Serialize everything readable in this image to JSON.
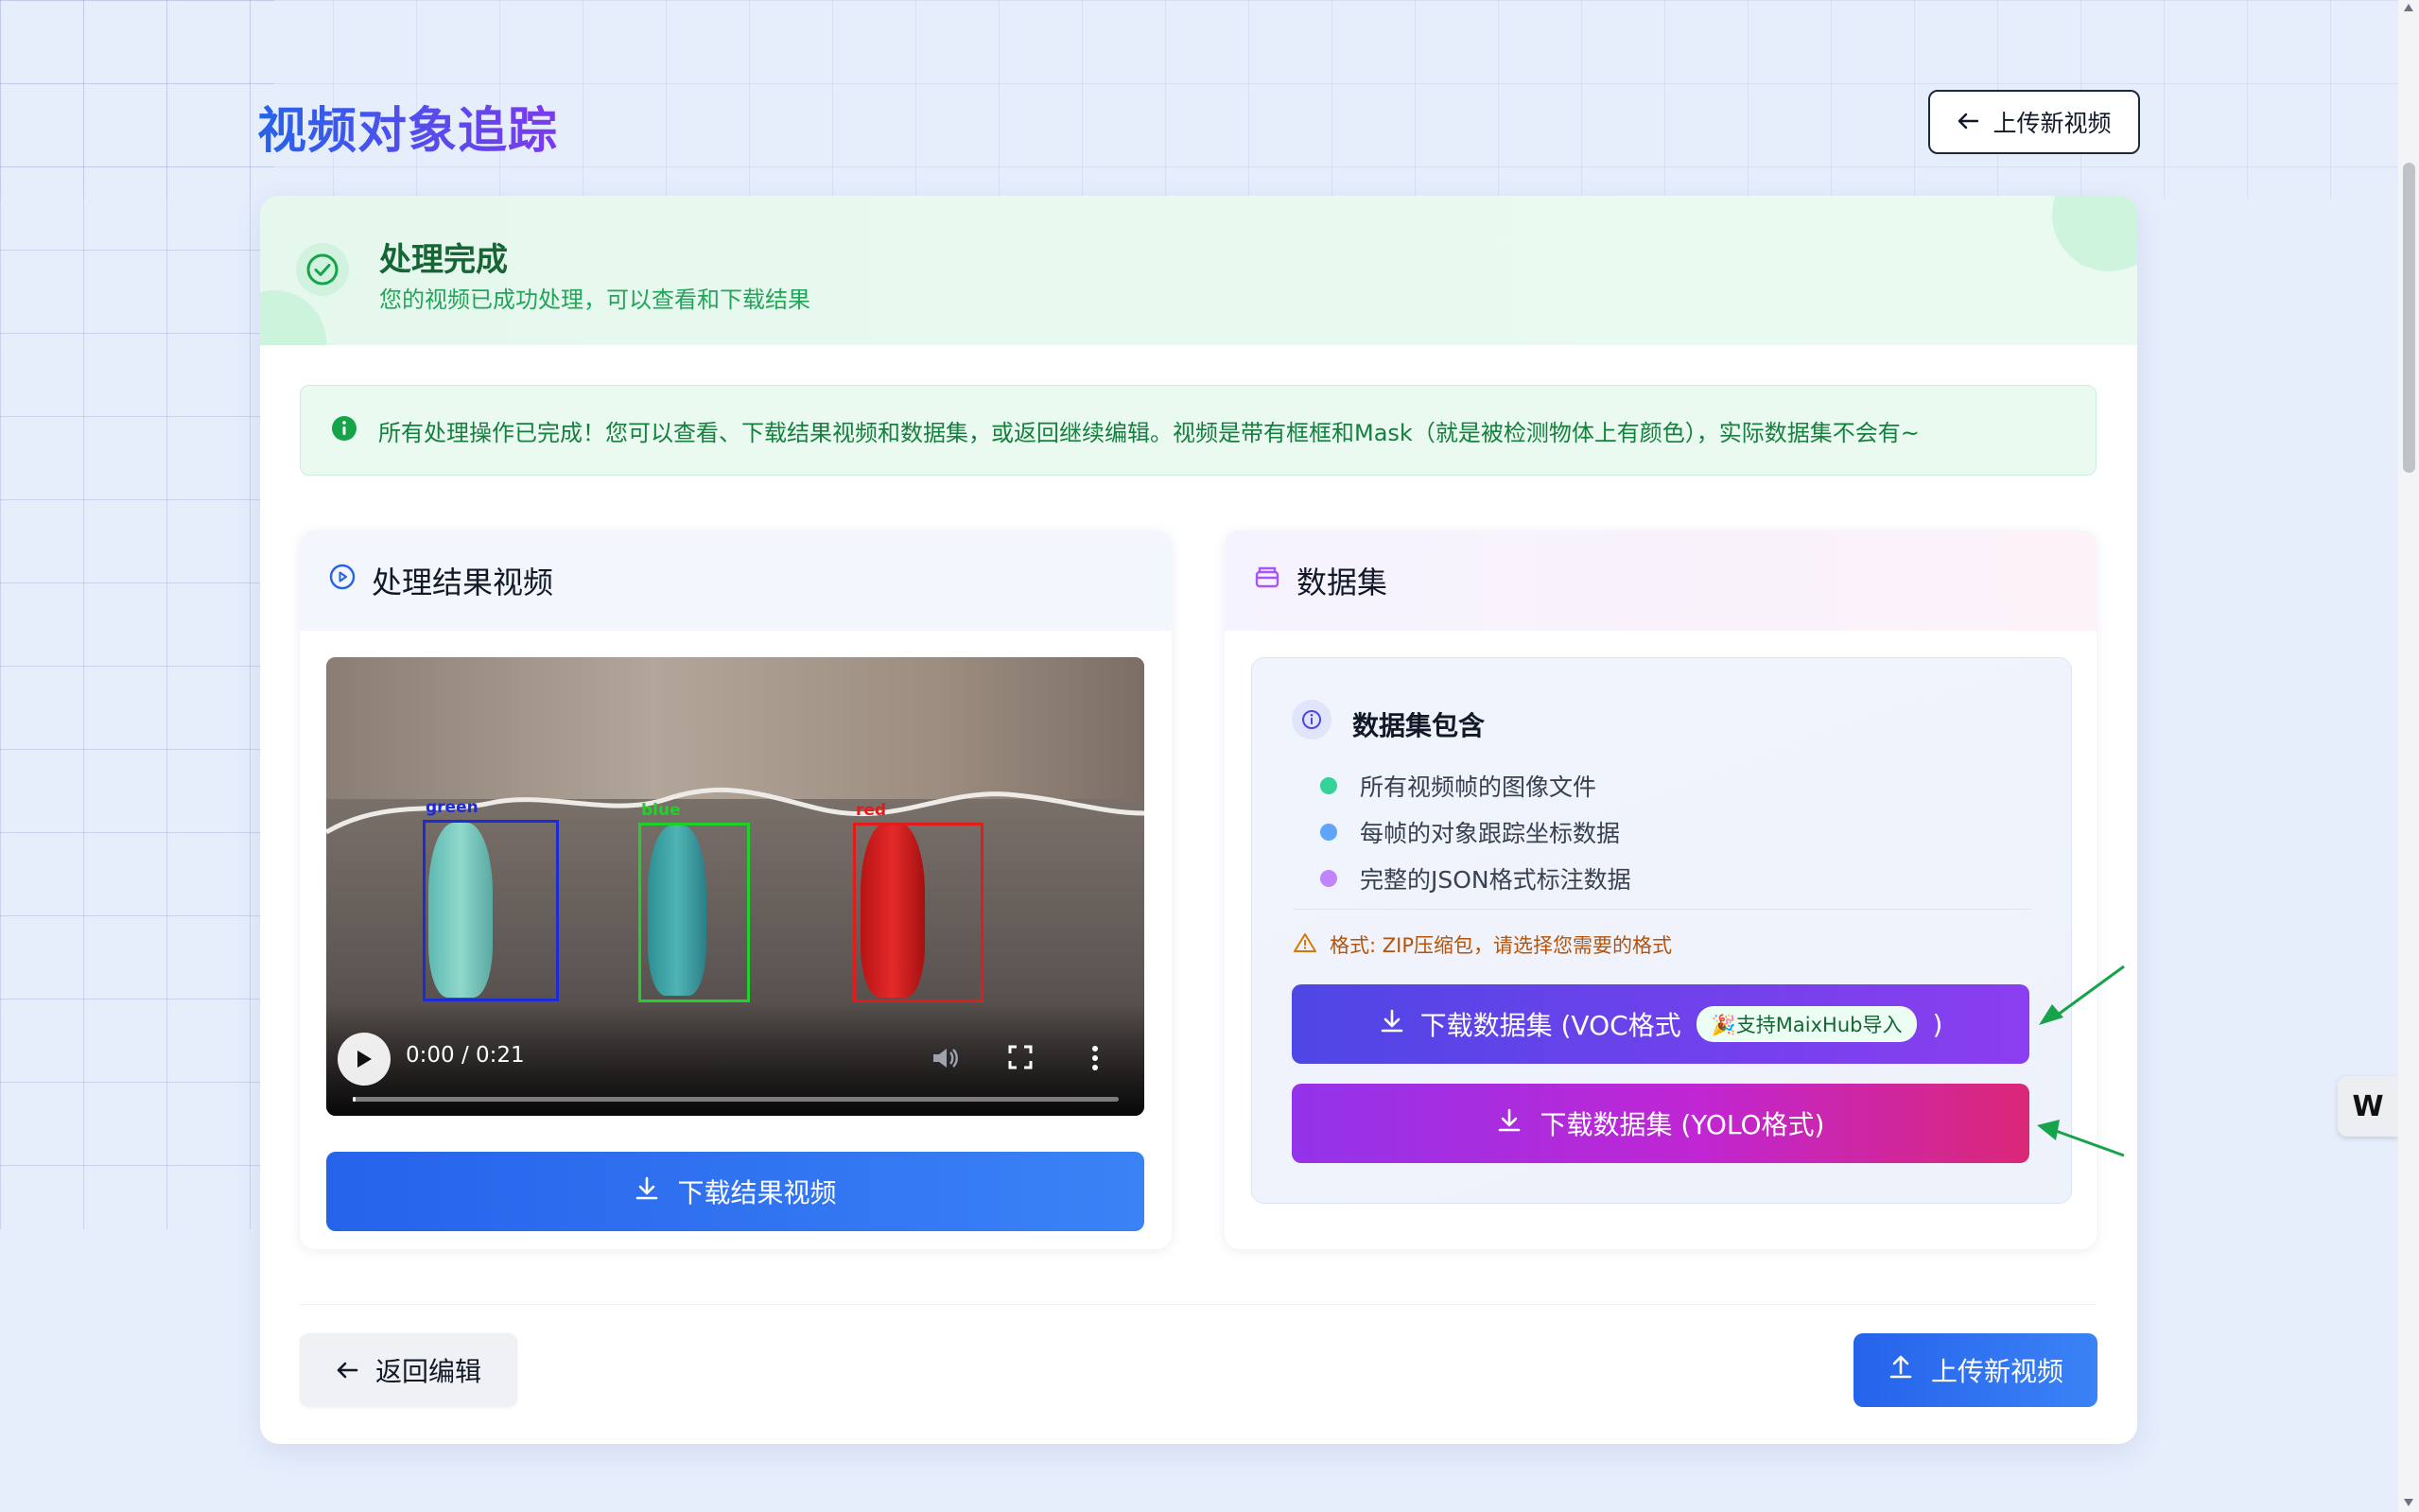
{
  "page": {
    "title": "视频对象追踪"
  },
  "header": {
    "upload_new_label": "上传新视频"
  },
  "status": {
    "title": "处理完成",
    "subtitle": "您的视频已成功处理，可以查看和下载结果"
  },
  "notice": {
    "text": "所有处理操作已完成！您可以查看、下载结果视频和数据集，或返回继续编辑。视频是带有框框和Mask（就是被检测物体上有颜色），实际数据集不会有~"
  },
  "video_panel": {
    "title": "处理结果视频",
    "player": {
      "time": "0:00 / 0:21",
      "progress": 0.0,
      "detections": [
        {
          "label": "green",
          "color": "#1d2bd6"
        },
        {
          "label": "blue",
          "color": "#1fd12b"
        },
        {
          "label": "red",
          "color": "#e21b1b"
        }
      ]
    },
    "download_label": "下载结果视频"
  },
  "dataset_panel": {
    "title": "数据集",
    "includes_title": "数据集包含",
    "items": [
      {
        "text": "所有视频帧的图像文件",
        "color": "#34d399"
      },
      {
        "text": "每帧的对象跟踪坐标数据",
        "color": "#60a5fa"
      },
      {
        "text": "完整的JSON格式标注数据",
        "color": "#c084fc"
      }
    ],
    "format_note": "格式: ZIP压缩包，请选择您需要的格式",
    "voc_label": "下载数据集 (VOC格式",
    "voc_badge": "🎉支持MaixHub导入",
    "voc_close": ")",
    "yolo_label": "下载数据集 (YOLO格式)"
  },
  "footer": {
    "back_label": "返回编辑",
    "upload_label": "上传新视频"
  },
  "side_widget": {
    "text": "W"
  },
  "colors": {
    "accent": "#2563eb",
    "success": "#166534",
    "annotation_arrow": "#16a34a"
  }
}
